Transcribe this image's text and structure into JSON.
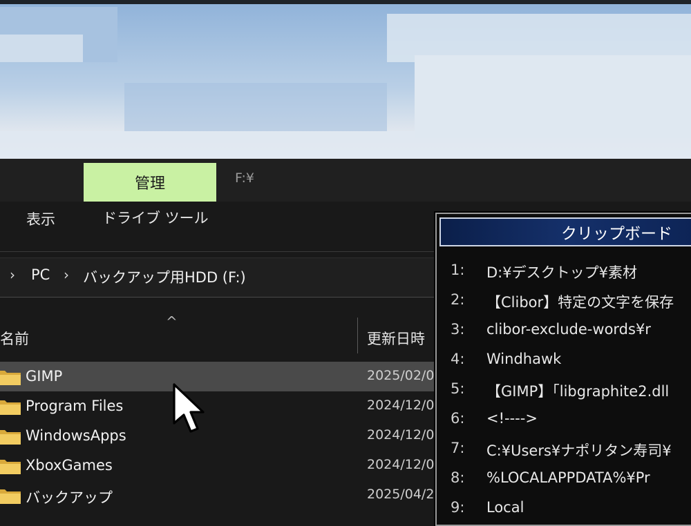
{
  "ribbon": {
    "manage_tab": "管理",
    "drive_path": "F:¥",
    "view_tab": "表示",
    "drive_tools_tab": "ドライブ ツール"
  },
  "address_bar": {
    "crumbs": [
      "PC",
      "バックアップ用HDD (F:)"
    ]
  },
  "columns": {
    "name": "名前",
    "modified": "更新日時"
  },
  "files": [
    {
      "name": "GIMP",
      "date": "2025/02/0",
      "selected": true
    },
    {
      "name": "Program Files",
      "date": "2024/12/0"
    },
    {
      "name": "WindowsApps",
      "date": "2024/12/0"
    },
    {
      "name": "XboxGames",
      "date": "2024/12/0"
    },
    {
      "name": "バックアップ",
      "date": "2025/04/2"
    }
  ],
  "clipboard": {
    "title": "クリップボード",
    "items": [
      {
        "num": "1:",
        "text": "D:¥デスクトップ¥素材"
      },
      {
        "num": "2:",
        "text": "【Clibor】特定の文字を保存"
      },
      {
        "num": "3:",
        "text": "clibor-exclude-words¥r"
      },
      {
        "num": "4:",
        "text": "Windhawk"
      },
      {
        "num": "5:",
        "text": "【GIMP】「libgraphite2.dll"
      },
      {
        "num": "6:",
        "text": "<!---->"
      },
      {
        "num": "7:",
        "text": "C:¥Users¥ナポリタン寿司¥"
      },
      {
        "num": "8:",
        "text": "%LOCALAPPDATA%¥Pr"
      },
      {
        "num": "9:",
        "text": "Local"
      }
    ]
  },
  "colors": {
    "manage_tab_bg": "#c9f1a3",
    "clipboard_title_bg": "#15306a",
    "selected_row_bg": "#4a4a4a"
  },
  "icons": [
    "folder-icon",
    "chevron-right-icon",
    "sort-ascending-icon",
    "mouse-cursor-icon"
  ]
}
